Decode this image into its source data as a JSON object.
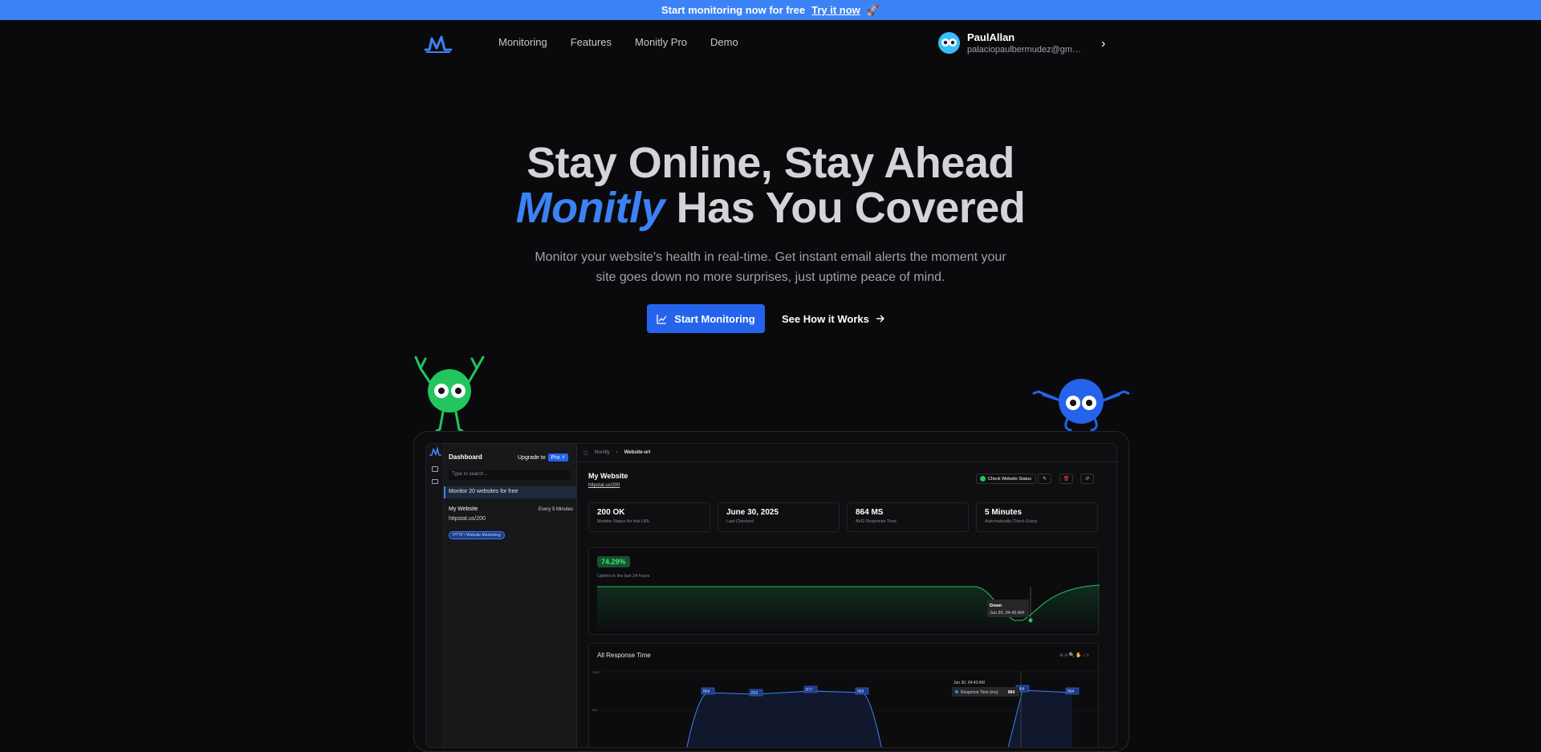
{
  "banner": {
    "text": "Start monitoring now for free",
    "link": "Try it now",
    "emoji": "🚀"
  },
  "nav": {
    "links": [
      "Monitoring",
      "Features",
      "Monitly Pro",
      "Demo"
    ],
    "user_name": "PaulAllan",
    "user_email": "palaciopaulbermudez@gma..."
  },
  "hero": {
    "line1": "Stay Online, Stay Ahead",
    "accent": "Monitly",
    "line2_rest": " Has You Covered",
    "subtitle": "Monitor your website's health in real-time. Get instant email alerts the moment your site goes down no more surprises, just uptime peace of mind.",
    "cta_primary": "Start Monitoring",
    "cta_secondary": "See How it Works"
  },
  "dashboard": {
    "sidebar": {
      "title": "Dashboard",
      "upgrade": "Upgrade to",
      "pro": "Pro",
      "search_placeholder": "Type to search...",
      "promo": "Monitor 20 websites for free",
      "site_name": "My Website",
      "site_interval": "Every 5 Minutes",
      "site_url": "httpstat.us/200",
      "site_tag": "HTTP / Website Monitoring"
    },
    "breadcrumb": {
      "root": "Monitly",
      "current": "Website-url"
    },
    "site_title": "My Website",
    "site_url": "httpstat.us/200",
    "check_button": "Check Website Status",
    "stats": [
      {
        "value": "200 OK",
        "label": "Monitor Status for this URL"
      },
      {
        "value": "June 30, 2025",
        "label": "Last Checked"
      },
      {
        "value": "864 MS",
        "label": "AVG Response Time"
      },
      {
        "value": "5 Minutes",
        "label": "Automatically Check Every"
      }
    ],
    "uptime": {
      "percent": "74.29%",
      "label": "Uptime in the last 24 hours",
      "tooltip_title": "Down",
      "tooltip_date": "Jun 30, 04:43 AM"
    },
    "response": {
      "title": "All Response Time",
      "ytick_top": "1000",
      "ytick_mid": "900",
      "tooltip_date": "Jun 30, 04:43 AM",
      "tooltip_series": "Response Time (ms):",
      "tooltip_value": "864",
      "point_labels": [
        "864",
        "853",
        "877",
        "869",
        "864",
        "864"
      ]
    }
  },
  "colors": {
    "accent": "#3b82f6",
    "banner": "#3b82f6",
    "green_mascot": "#22c55e",
    "blue_mascot": "#2563eb",
    "uptime_green": "#4ade80"
  }
}
